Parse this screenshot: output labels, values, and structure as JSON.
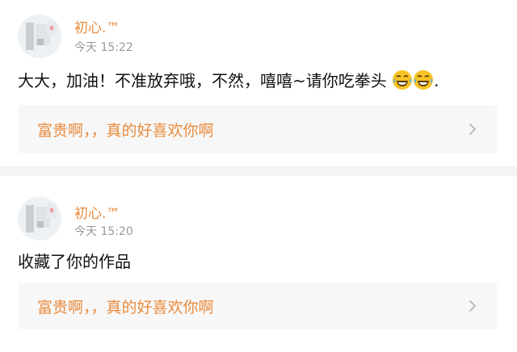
{
  "comments": [
    {
      "username": "初心.™",
      "time": "今天 15:22",
      "text_main": "大大，加油！不准放弃哦，不然，嘻嘻~请你吃拳头",
      "text_tail": ".",
      "emojis": [
        "laughing-tears",
        "laughing-tears"
      ],
      "quote": "富贵啊，，真的好喜欢你啊"
    },
    {
      "username": "初心.™",
      "time": "今天 15:20",
      "text_main": "收藏了你的作品",
      "quote": "富贵啊，，真的好喜欢你啊"
    }
  ],
  "colors": {
    "username": "#e98b3c",
    "quote_text": "#e98b3c",
    "time": "#9a9a9a",
    "quote_bg": "#f7f7f7",
    "separator": "#f4f4f4"
  }
}
